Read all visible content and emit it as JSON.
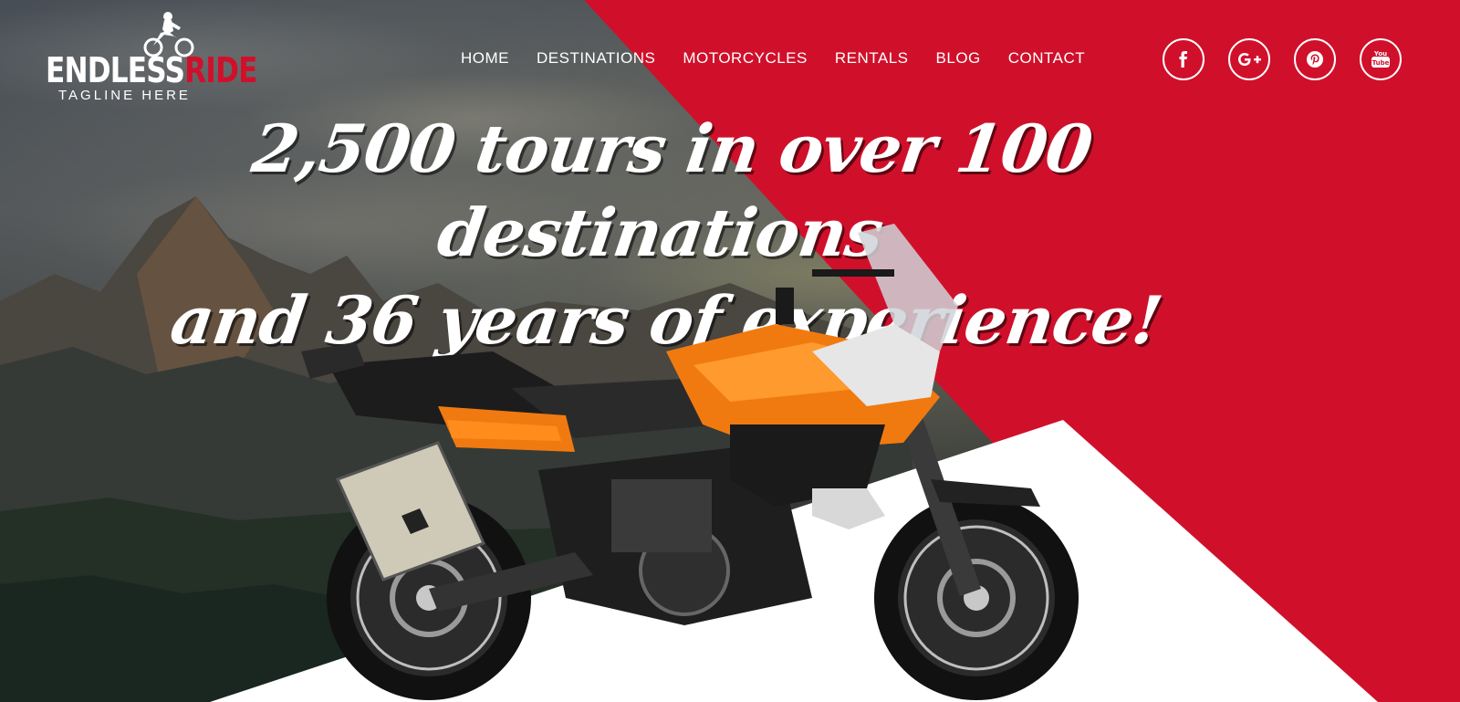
{
  "logo": {
    "word_main": "ENDLESS",
    "word_accent": "RIDE",
    "tagline": "TAGLINE HERE"
  },
  "nav": {
    "items": [
      "HOME",
      "DESTINATIONS",
      "MOTORCYCLES",
      "RENTALS",
      "BLOG",
      "CONTACT"
    ]
  },
  "social": {
    "icons": [
      {
        "name": "facebook-icon",
        "glyph": "f"
      },
      {
        "name": "google-plus-icon",
        "glyph": "G+"
      },
      {
        "name": "pinterest-icon",
        "glyph": "P"
      },
      {
        "name": "youtube-icon",
        "glyph": "You"
      }
    ]
  },
  "hero": {
    "headline_line1": "2,500 tours in over 100 destinations",
    "headline_line2": "and 36 years of experience!"
  },
  "colors": {
    "brand_red": "#d0102b",
    "white": "#ffffff",
    "bike_orange": "#f07a10"
  }
}
